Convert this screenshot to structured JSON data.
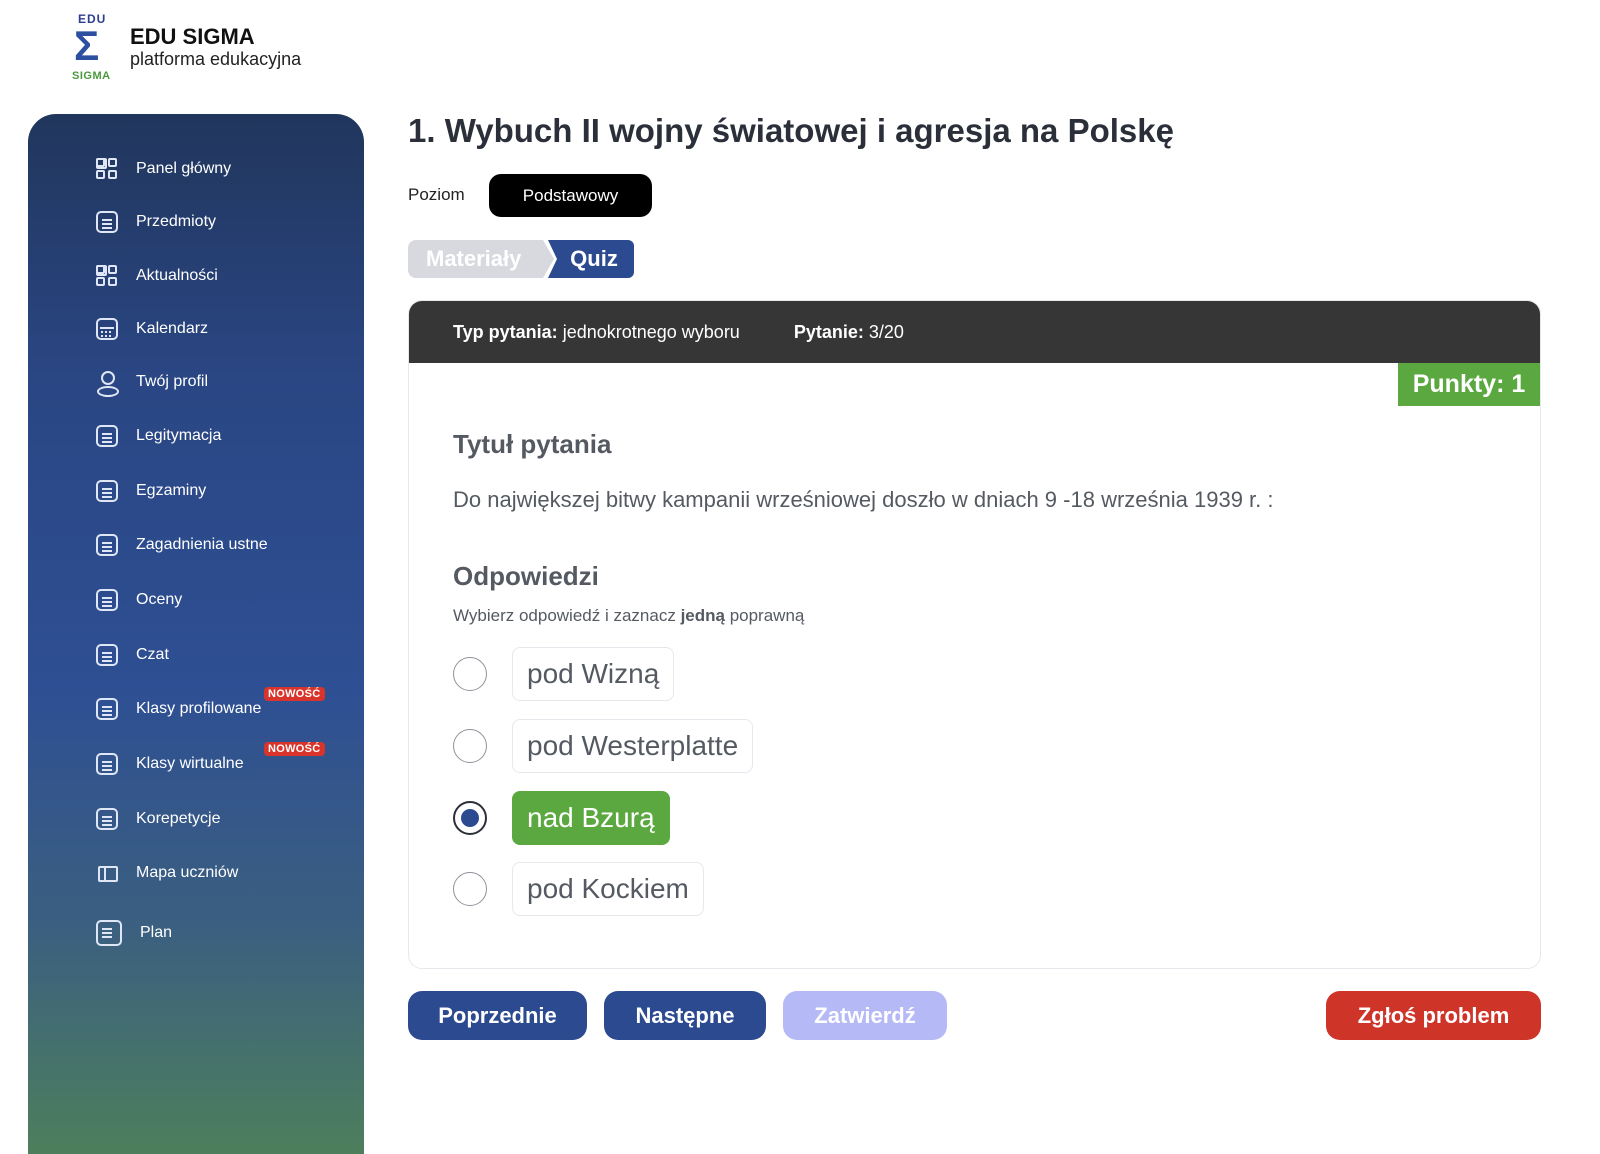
{
  "brand": {
    "mark_top": "EDU",
    "mark_symbol": "Σ",
    "mark_bottom": "SIGMA",
    "title": "EDU SIGMA",
    "subtitle": "platforma edukacyjna"
  },
  "sidebar": {
    "items": [
      {
        "label": "Panel główny",
        "icon": "grid-icon"
      },
      {
        "label": "Przedmioty",
        "icon": "document-icon"
      },
      {
        "label": "Aktualności",
        "icon": "grid-icon"
      },
      {
        "label": "Kalendarz",
        "icon": "calendar-icon"
      },
      {
        "label": "Twój profil",
        "icon": "user-icon"
      },
      {
        "label": "Legitymacja",
        "icon": "document-icon"
      },
      {
        "label": "Egzaminy",
        "icon": "document-icon"
      },
      {
        "label": "Zagadnienia ustne",
        "icon": "document-icon"
      },
      {
        "label": "Oceny",
        "icon": "document-icon"
      },
      {
        "label": "Czat",
        "icon": "document-icon"
      },
      {
        "label": "Klasy profilowane",
        "icon": "document-icon",
        "badge": "NOWOŚĆ"
      },
      {
        "label": "Klasy wirtualne",
        "icon": "document-icon",
        "badge": "NOWOŚĆ"
      },
      {
        "label": "Korepetycje",
        "icon": "document-icon"
      },
      {
        "label": "Mapa uczniów",
        "icon": "map-icon"
      },
      {
        "label": "Plan",
        "icon": "document-icon"
      }
    ]
  },
  "main": {
    "title": "1. Wybuch II wojny światowej i agresja na Polskę",
    "level_label": "Poziom",
    "level_value": "Podstawowy",
    "tabs": [
      {
        "label": "Materiały",
        "active": false
      },
      {
        "label": "Quiz",
        "active": true
      }
    ]
  },
  "question": {
    "type_label": "Typ pytania:",
    "type_value": "jednokrotnego wyboru",
    "number_label": "Pytanie:",
    "number_value": "3/20",
    "points": "Punkty: 1",
    "title_heading": "Tytuł pytania",
    "text": "Do największej bitwy kampanii wrześniowej doszło w dniach 9 -18 września 1939 r. :",
    "answers_heading": "Odpowiedzi",
    "hint_before": "Wybierz odpowiedź i zaznacz ",
    "hint_bold": "jedną",
    "hint_after": " poprawną",
    "answers": [
      {
        "text": "pod Wizną",
        "selected": false,
        "correct": false
      },
      {
        "text": "pod Westerplatte",
        "selected": false,
        "correct": false
      },
      {
        "text": "nad Bzurą",
        "selected": true,
        "correct": true
      },
      {
        "text": "pod Kockiem",
        "selected": false,
        "correct": false
      }
    ]
  },
  "actions": {
    "prev": "Poprzednie",
    "next": "Następne",
    "confirm": "Zatwierdź",
    "report": "Zgłoś problem"
  },
  "colors": {
    "primary": "#2c4a8f",
    "success": "#5aa83f",
    "danger": "#cf3429",
    "disabled": "#b5b9f5"
  }
}
